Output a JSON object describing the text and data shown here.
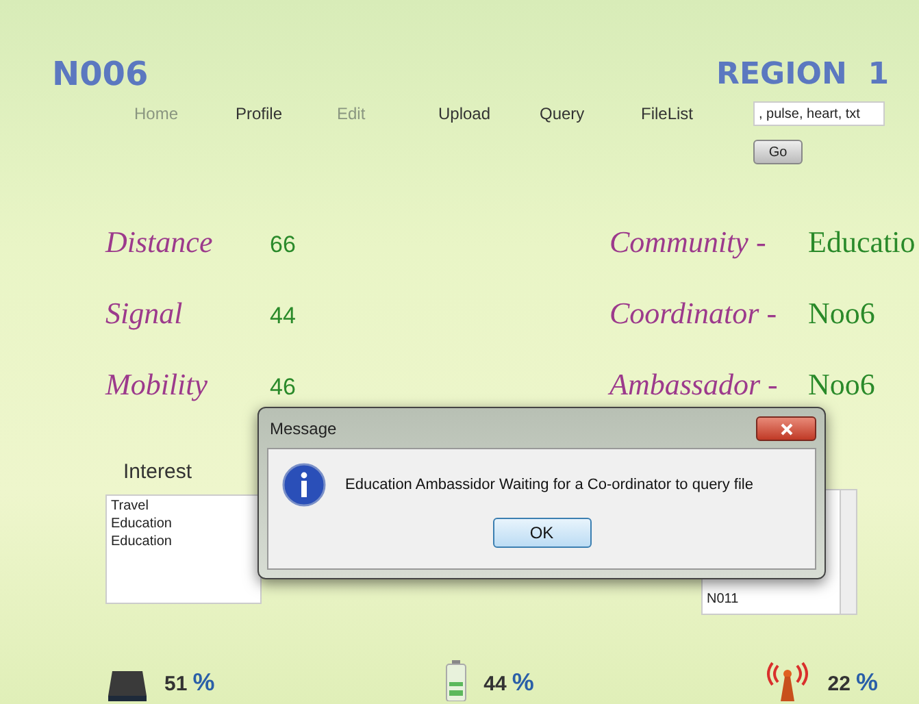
{
  "header": {
    "node": "N006",
    "region": "REGION  1"
  },
  "nav": [
    {
      "label": "Home",
      "disabled": true
    },
    {
      "label": "Profile",
      "disabled": false
    },
    {
      "label": "Edit",
      "disabled": true
    },
    {
      "label": "Upload",
      "disabled": false
    },
    {
      "label": "Query",
      "disabled": false
    },
    {
      "label": "FileList",
      "disabled": false
    }
  ],
  "search": {
    "value": ", pulse, heart, txt",
    "button": "Go"
  },
  "stats": [
    {
      "label": "Distance",
      "value": "66"
    },
    {
      "label": "Signal",
      "value": "44"
    },
    {
      "label": "Mobility",
      "value": "46"
    }
  ],
  "roles": [
    {
      "label": "Community -",
      "value": "Educatio"
    },
    {
      "label": "Coordinator -",
      "value": "Noo6"
    },
    {
      "label": "Ambassador -",
      "value": "Noo6"
    }
  ],
  "interest": {
    "label": "Interest",
    "items": [
      "Travel",
      "Education",
      "Education"
    ]
  },
  "node_list": {
    "items": [
      "N011"
    ]
  },
  "dialog": {
    "title": "Message",
    "message": "Education Ambassidor Waiting for a Co-ordinator to query file",
    "button": "OK"
  },
  "status": [
    {
      "kind": "disk",
      "reading": "51",
      "unit": "%"
    },
    {
      "kind": "battery",
      "reading": "44",
      "unit": "%"
    },
    {
      "kind": "antenna",
      "reading": "22",
      "unit": "%"
    }
  ]
}
